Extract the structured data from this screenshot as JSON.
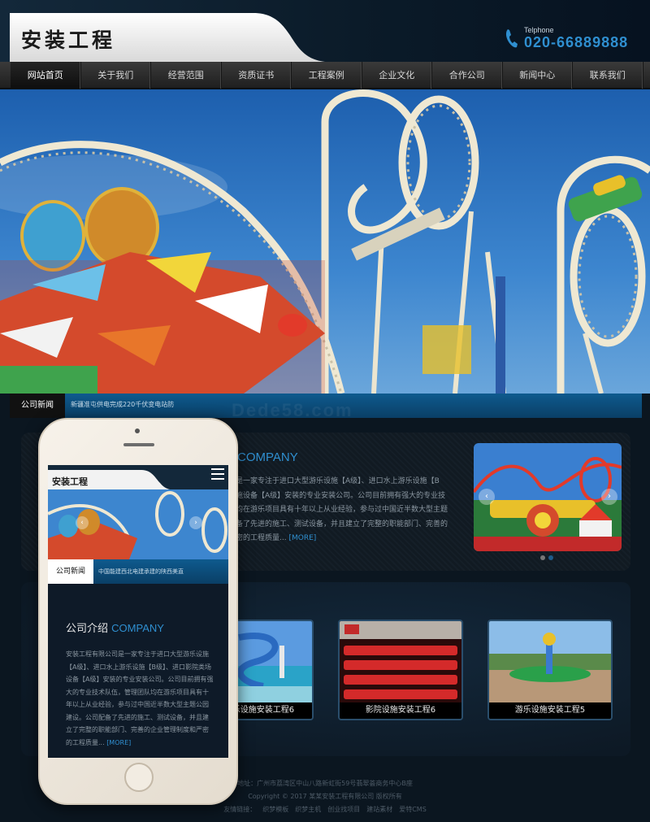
{
  "header": {
    "logo_text": "安装工程",
    "tel_label": "Telphone",
    "tel_number": "020-66889888"
  },
  "nav": {
    "items": [
      "网站首页",
      "关于我们",
      "经营范围",
      "资质证书",
      "工程案例",
      "企业文化",
      "合作公司",
      "新闻中心",
      "联系我们"
    ],
    "active_index": 0
  },
  "news": {
    "label": "公司新闻",
    "headline": "新疆准屯供电完成220千伏变电站防"
  },
  "watermark": "Dede58.com",
  "about": {
    "title_en": "COMPANY",
    "lines": [
      "是一家专注于进口大型游乐设施【A级】、进口水上游乐设施【B",
      "施设备【A级】安装的专业安装公司。公司目前拥有强大的专业技",
      "均在游乐项目具有十年以上从业经验，参与过中国近半数大型主题",
      "备了先进的施工、测试设备，并且建立了完整的职能部门、完善的",
      "密的工程质量..."
    ],
    "more": "[MORE]",
    "slider_prev": "‹",
    "slider_next": "›"
  },
  "cases": [
    {
      "caption": "水上游乐设施安装工程6"
    },
    {
      "caption": "影院设施安装工程6"
    },
    {
      "caption": "游乐设施安装工程5"
    }
  ],
  "footer": {
    "address": "地址：广州市荔湾区中山八路新虹街59号翡翠荟商务中心B座",
    "copyright": "Copyright © 2017 某某安装工程有限公司 版权所有",
    "links_label": "友情链接：",
    "links": [
      "织梦模板",
      "织梦主机",
      "创业找项目",
      "建站素材",
      "爱特CMS"
    ]
  },
  "mobile": {
    "logo_text": "安装工程",
    "news_label": "公司新闻",
    "news_text": "中国能建西北电建承建的陕西美直",
    "intro_title": "公司介绍",
    "intro_title_en": "COMPANY",
    "intro_body": "安装工程有限公司是一家专注于进口大型游乐设施【A级】、进口水上游乐设施【B级】、进口影院类场设备【A级】安装的专业安装公司。公司目前拥有强大的专业技术队伍，管理团队均在游乐项目具有十年以上从业经验，参与过中国近半数大型主题公园建设。公司配备了先进的施工、测试设备，并且建立了完整的职能部门、完善的企业管理制度和严密的工程质量...",
    "more": "[MORE]"
  },
  "colors": {
    "accent": "#2f8fd0",
    "page_bg": "#0b1620",
    "nav_bg": "#2a2a2a",
    "news_bar": "#0e5a8e"
  }
}
